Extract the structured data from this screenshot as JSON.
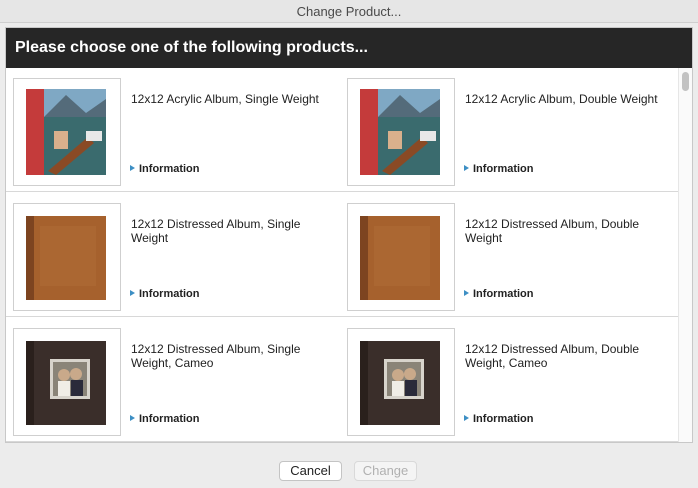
{
  "window": {
    "title": "Change Product..."
  },
  "header": {
    "title": "Please choose one of the following products..."
  },
  "products": [
    {
      "name": "12x12 Acrylic Album, Single Weight",
      "info": "Information",
      "image": "acrylic-album-image"
    },
    {
      "name": "12x12 Acrylic Album, Double Weight",
      "info": "Information",
      "image": "acrylic-album-image"
    },
    {
      "name": "12x12 Distressed Album, Single Weight",
      "info": "Information",
      "image": "distressed-album-image"
    },
    {
      "name": "12x12 Distressed Album, Double Weight",
      "info": "Information",
      "image": "distressed-album-image"
    },
    {
      "name": "12x12 Distressed Album, Single Weight, Cameo",
      "info": "Information",
      "image": "cameo-album-image"
    },
    {
      "name": "12x12 Distressed Album, Double Weight, Cameo",
      "info": "Information",
      "image": "cameo-album-image"
    }
  ],
  "buttons": {
    "cancel": "Cancel",
    "change": "Change"
  },
  "colors": {
    "header_bg": "#262626",
    "info_arrow": "#3d8fc4"
  }
}
